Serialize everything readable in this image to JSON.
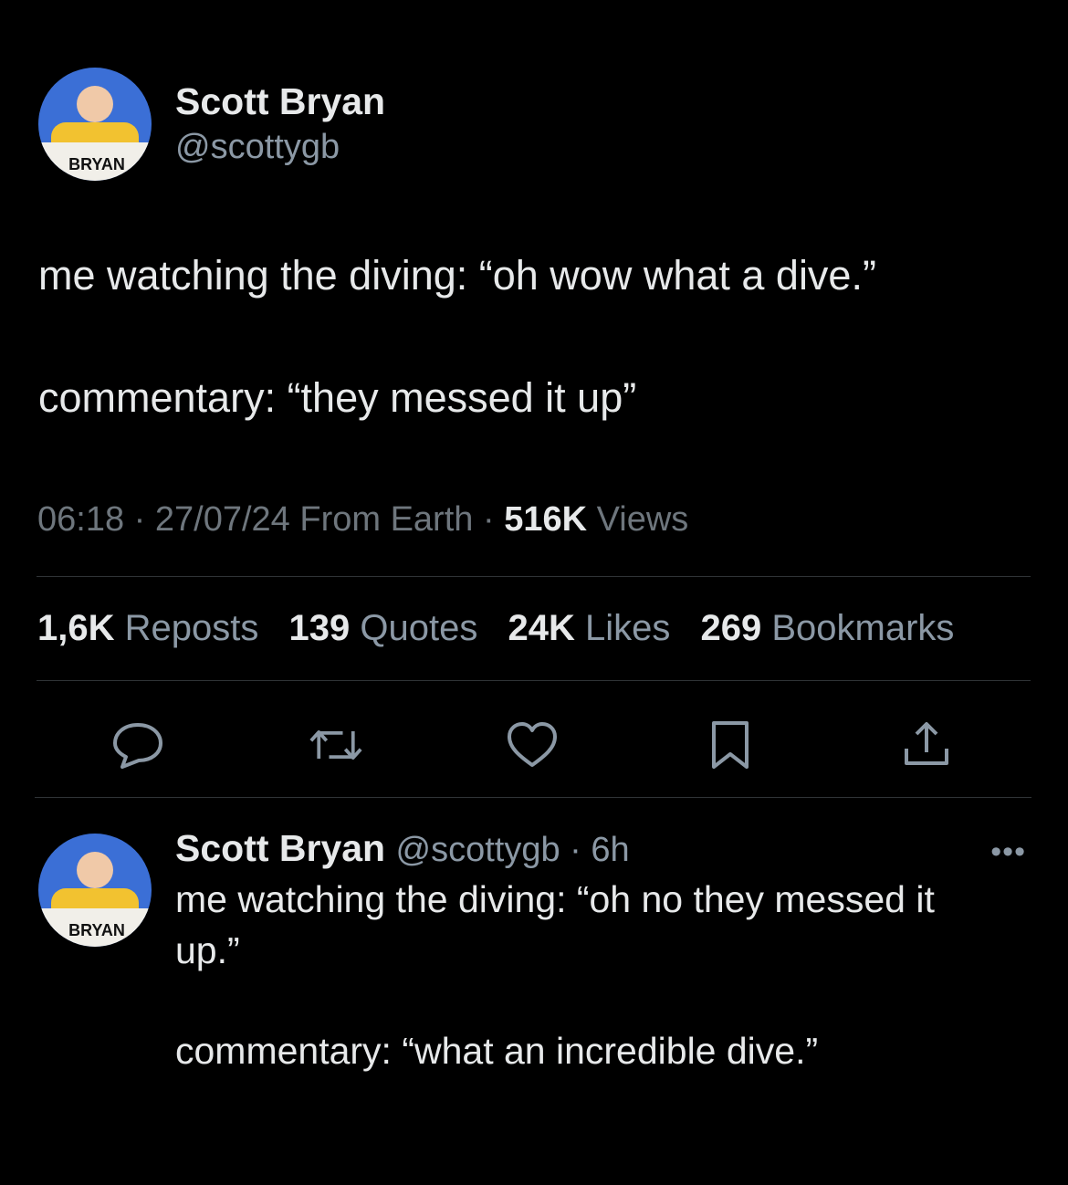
{
  "tweet": {
    "author_name": "Scott Bryan",
    "author_handle": "@scottygb",
    "avatar_label": "BRYAN",
    "body_line1": "me watching the diving: “oh wow what a dive.”",
    "body_line2": "commentary: “they messed it up”",
    "time": "06:18",
    "date": "27/07/24",
    "source": "From Earth",
    "views_count": "516K",
    "views_label": "Views",
    "stats": [
      {
        "count": "1,6K",
        "label": "Reposts"
      },
      {
        "count": "139",
        "label": "Quotes"
      },
      {
        "count": "24K",
        "label": "Likes"
      },
      {
        "count": "269",
        "label": "Bookmarks"
      }
    ]
  },
  "reply": {
    "author_name": "Scott Bryan",
    "author_handle": "@scottygb",
    "age": "6h",
    "avatar_label": "BRYAN",
    "body_line1": "me watching the diving: “oh no they messed it",
    "body_line2": "up.”",
    "body_line3": "commentary: “what an incredible dive.”",
    "more_label": "•••"
  },
  "actions": [
    "reply-icon",
    "repost-icon",
    "like-icon",
    "bookmark-icon",
    "share-icon"
  ],
  "colors": {
    "background": "#000000",
    "text": "#e7e9ea",
    "secondary": "#6e767d",
    "divider": "#2f3336",
    "avatar_bg": "#3b6fd6",
    "shirt": "#f2c230"
  }
}
